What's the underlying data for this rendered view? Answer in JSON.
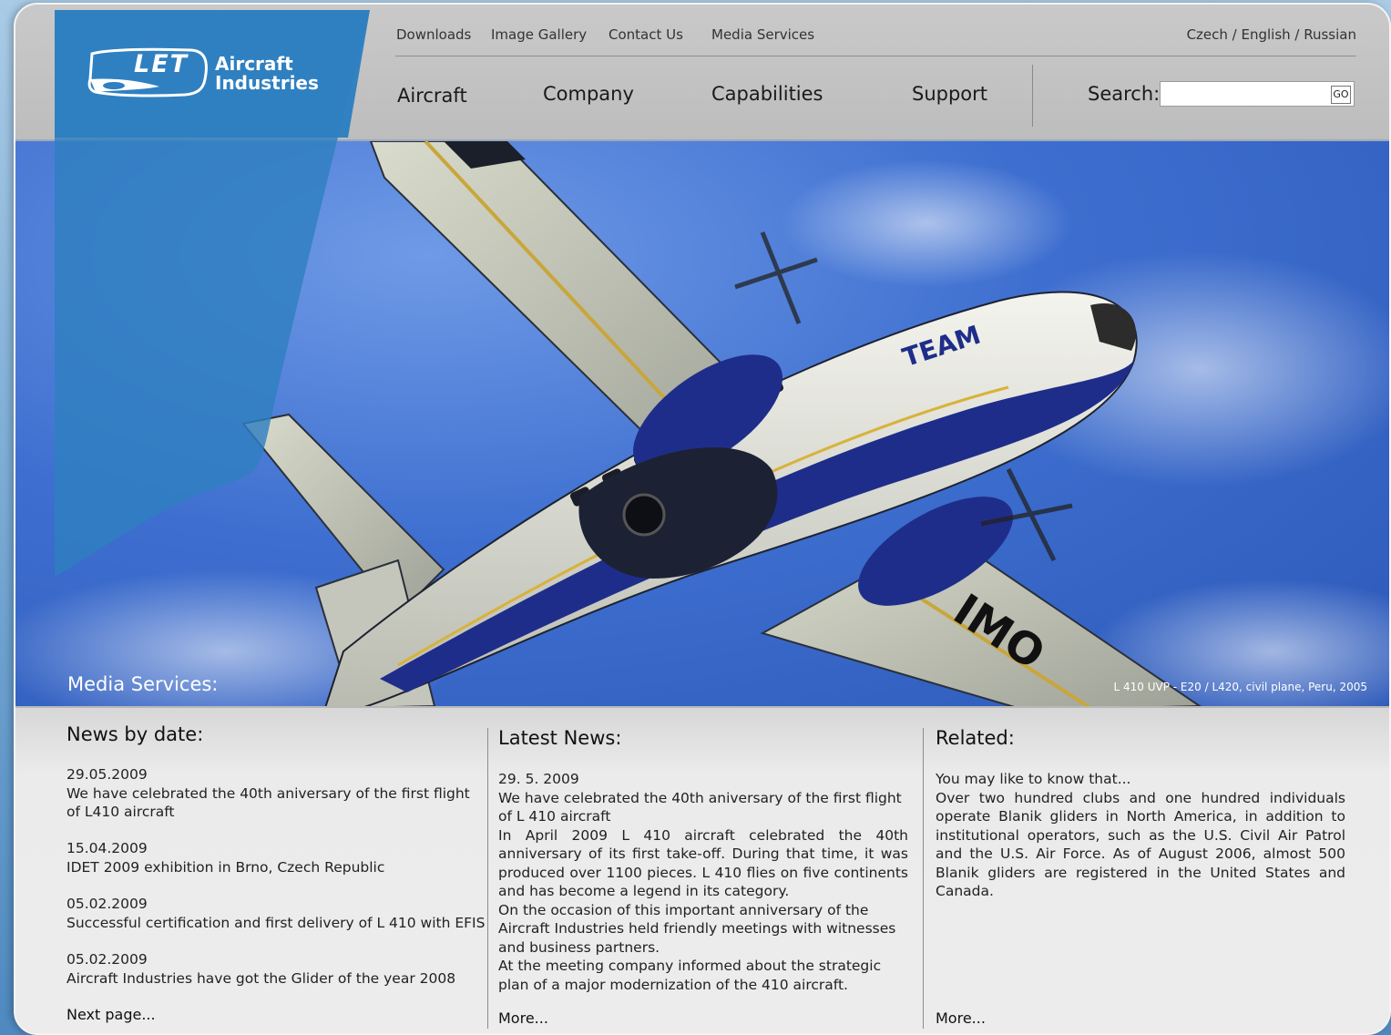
{
  "header": {
    "top_links": [
      "Downloads",
      "Image Gallery",
      "Contact Us",
      "Media Services"
    ],
    "languages": "Czech / English / Russian",
    "main_nav": [
      "Aircraft",
      "Company",
      "Capabilities",
      "Support"
    ],
    "search_label": "Search:",
    "search_value": "",
    "go_label": "GO"
  },
  "logo": {
    "mark": "LET",
    "line1": "Aircraft",
    "line2": "Industries"
  },
  "hero": {
    "caption": "Media Services:",
    "photo_credit": "L 410 UVP - E20 / L420, civil plane, Peru, 2005",
    "plane_markings": [
      "TEAM",
      "IMO"
    ]
  },
  "news_by_date": {
    "title": "News by date:",
    "items": [
      {
        "date": "29.05.2009",
        "text": "We have celebrated the 40th aniversary of the first flight of L410 aircraft"
      },
      {
        "date": "15.04.2009",
        "text": "IDET 2009 exhibition in Brno, Czech Republic"
      },
      {
        "date": "05.02.2009",
        "text": "Successful certification and first delivery of L 410 with EFIS"
      },
      {
        "date": "05.02.2009",
        "text": "Aircraft Industries have got the Glider of the year 2008"
      }
    ],
    "next_label": "Next page..."
  },
  "latest_news": {
    "title": "Latest News:",
    "date": "29. 5. 2009",
    "paragraphs": [
      "We have celebrated the 40th aniversary of the first flight of L 410 aircraft",
      "In April 2009 L 410 aircraft celebrated the 40th anniversary of its first take-off. During that time, it was produced over 1100 pieces. L 410 flies on five continents and  has become a legend in its category.",
      "On the occasion of this important anniversary of the Aircraft Industries held friendly meetings with witnesses and business partners.",
      "At the meeting company informed about the strategic plan of a major modernization of the 410 aircraft."
    ],
    "more_label": "More..."
  },
  "related": {
    "title": "Related:",
    "intro": "You may like to know that...",
    "body": "Over two hundred clubs and one hundred individuals operate Blanik gliders in North America, in addition to institutional operators, such as the U.S. Civil Air Patrol and the U.S. Air Force. As of August 2006, almost 500 Blanik gliders are registered in the United States and Canada.",
    "more_label": "More..."
  },
  "colors": {
    "brand_blue": "#2f7fc1",
    "sky_blue": "#3e6fd0",
    "panel_grey": "#c8c8c8"
  }
}
